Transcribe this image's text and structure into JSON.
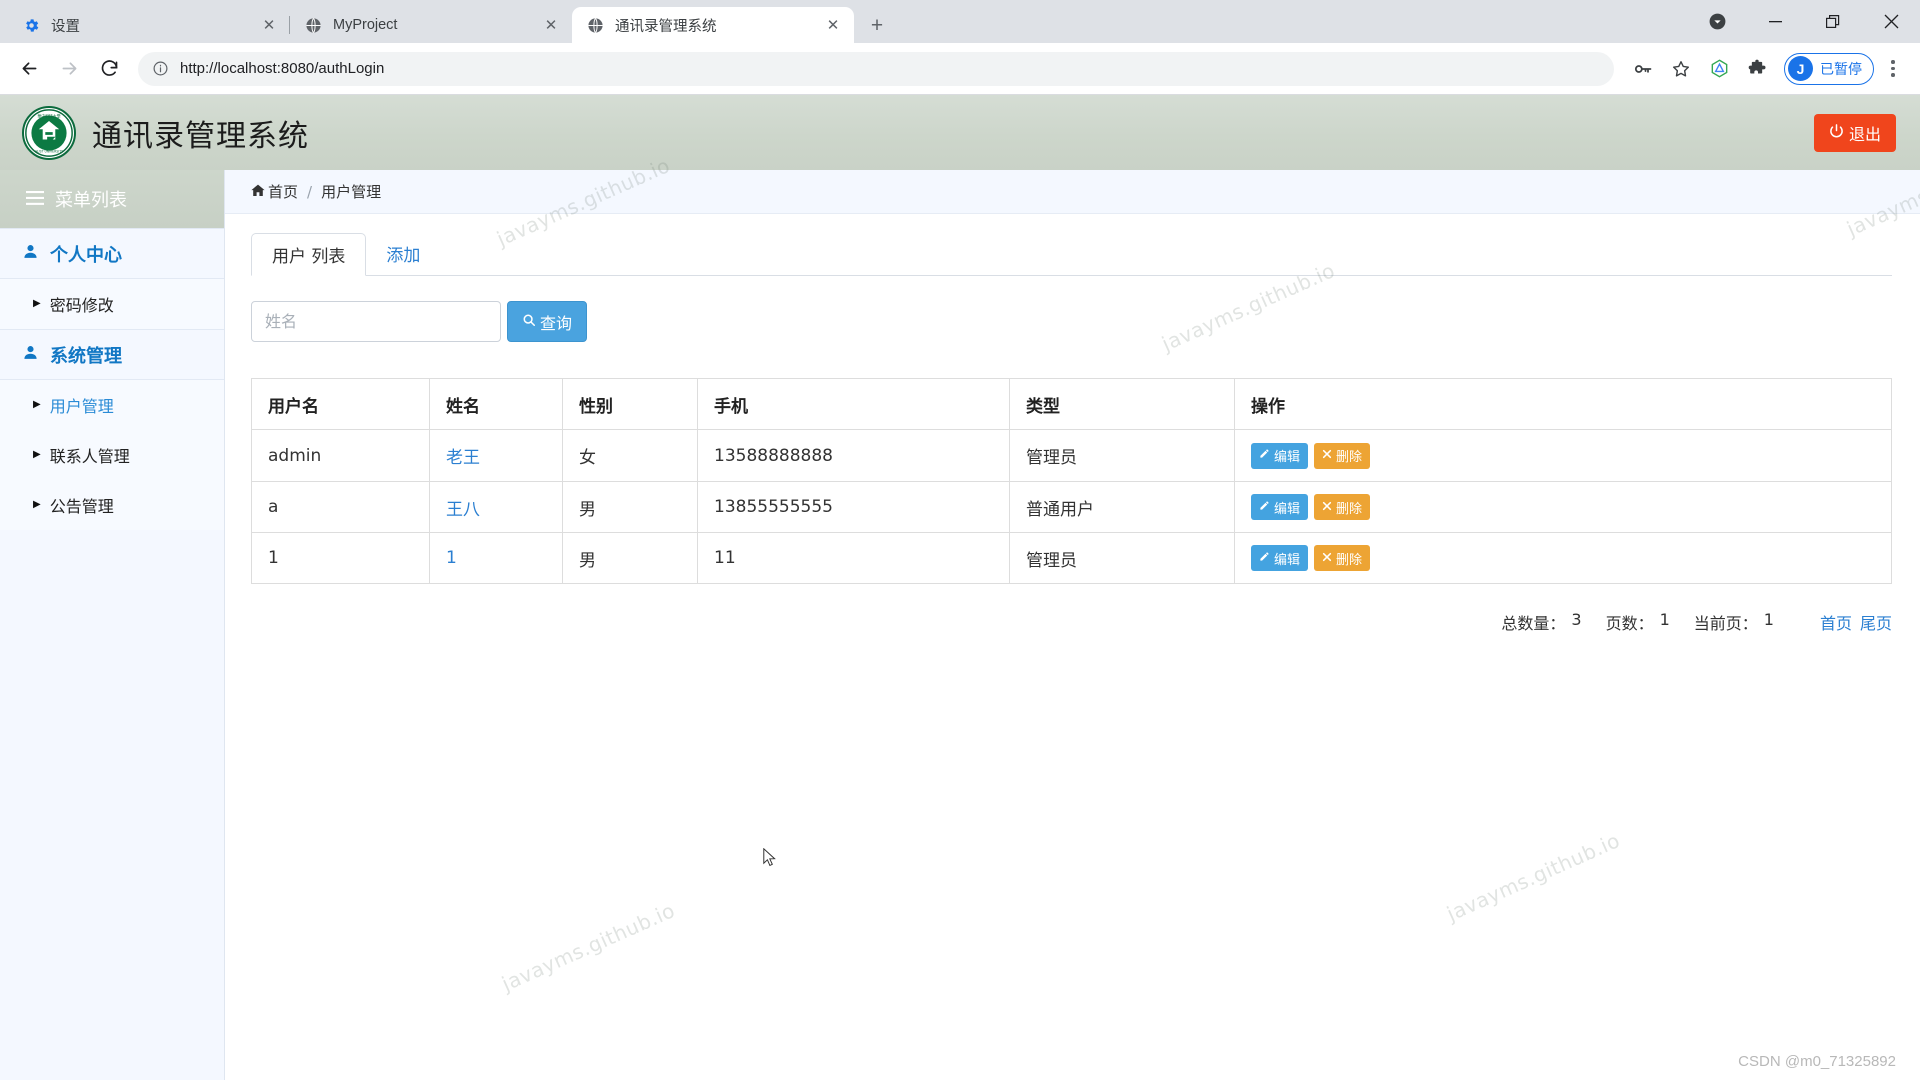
{
  "browser": {
    "tabs": [
      {
        "title": "设置",
        "favicon": "gear-icon",
        "active": false
      },
      {
        "title": "MyProject",
        "favicon": "globe-icon",
        "active": false
      },
      {
        "title": "通讯录管理系统",
        "favicon": "globe-icon",
        "active": true
      }
    ],
    "new_tab_label": "+",
    "window_controls": {
      "download": "download-icon",
      "minimize": "−",
      "restore": "restore-icon",
      "close": "×"
    },
    "toolbar": {
      "back": "back-arrow-icon",
      "forward": "forward-arrow-icon",
      "reload": "reload-icon",
      "site_info": "info-icon",
      "url_scheme": "http://",
      "url_host": "localhost:8080",
      "url_path": "/authLogin",
      "url_full": "http://localhost:8080/authLogin",
      "password_icon": "key-icon",
      "bookmark_icon": "star-icon",
      "extension_a_icon": "diamond-icon",
      "extension_b_icon": "puzzle-icon",
      "profile_initial": "J",
      "profile_status": "已暂停",
      "menu_icon": "three-dots-icon",
      "accent": "#1a73e8"
    }
  },
  "app": {
    "title": "通讯录管理系统",
    "logo_name": "university-emblem",
    "header_bg": "#ced7cd",
    "logout": {
      "label": "退出",
      "icon": "power-icon",
      "color": "#f0451c"
    }
  },
  "sidebar": {
    "header": {
      "label": "菜单列表",
      "icon": "list-icon"
    },
    "sections": [
      {
        "label": "个人中心",
        "icon": "user-icon",
        "items": [
          {
            "label": "密码修改",
            "active": false
          }
        ]
      },
      {
        "label": "系统管理",
        "icon": "user-icon",
        "items": [
          {
            "label": "用户管理",
            "active": true
          },
          {
            "label": "联系人管理",
            "active": false
          },
          {
            "label": "公告管理",
            "active": false
          }
        ]
      }
    ]
  },
  "breadcrumb": {
    "home": "首页",
    "separator": "/",
    "current": "用户管理"
  },
  "main": {
    "tabs": [
      {
        "label": "用户 列表",
        "active": true
      },
      {
        "label": "添加",
        "active": false
      }
    ],
    "search": {
      "placeholder": "姓名",
      "value": "",
      "button_label": "查询",
      "button_icon": "search-icon"
    },
    "table": {
      "columns": [
        "用户名",
        "姓名",
        "性别",
        "手机",
        "类型",
        "操作"
      ],
      "rows": [
        {
          "username": "admin",
          "name": "老王",
          "gender": "女",
          "phone": "13588888888",
          "type": "管理员",
          "edit_label": "编辑",
          "delete_label": "删除"
        },
        {
          "username": "a",
          "name": "王八",
          "gender": "男",
          "phone": "13855555555",
          "type": "普通用户",
          "edit_label": "编辑",
          "delete_label": "删除"
        },
        {
          "username": "1",
          "name": "1",
          "gender": "男",
          "phone": "11",
          "type": "管理员",
          "edit_label": "编辑",
          "delete_label": "删除"
        }
      ]
    },
    "pagination": {
      "total_label": "总数量：",
      "total_value": "3",
      "pages_label": "页数：",
      "pages_value": "1",
      "current_label": "当前页：",
      "current_value": "1",
      "first_page": "首页",
      "last_page": "尾页"
    }
  },
  "watermark": {
    "text": "javayms.github.io"
  },
  "footer": {
    "credit": "CSDN @m0_71325892"
  }
}
